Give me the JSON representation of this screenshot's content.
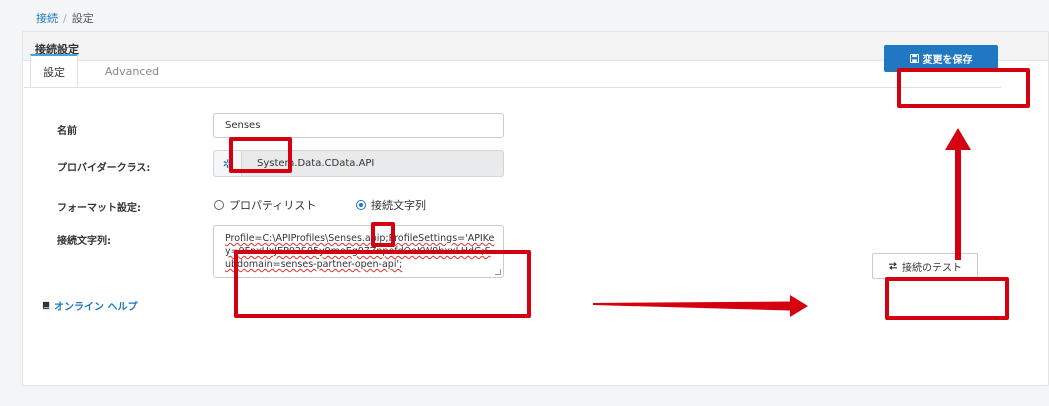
{
  "breadcrumb": {
    "parent": "接続",
    "separator": "/",
    "current": "設定"
  },
  "card": {
    "title": "接続設定"
  },
  "tabs": [
    {
      "label": "設定",
      "active": true
    },
    {
      "label": "Advanced",
      "active": false
    }
  ],
  "save_button": {
    "label": "変更を保存",
    "icon": "floppy-disk-icon"
  },
  "form": {
    "name": {
      "label": "名前",
      "value": "Senses"
    },
    "provider": {
      "label": "プロバイダークラス:",
      "value": "System.Data.CData.API",
      "icon": "gear-icon"
    },
    "format": {
      "label": "フォーマット設定:",
      "options": [
        {
          "label": "プロパティリスト",
          "selected": false
        },
        {
          "label": "接続文字列",
          "selected": true
        }
      ]
    },
    "connection_string": {
      "label": "接続文字列:",
      "value": "Profile=C:\\APIProfiles\\Senses.apip;ProfileSettings='APIKey=9FnxUxJEP02S05y9moEg97ZnpefdOoKW9bxxLHdG;Subdomain=senses-partner-open-api';"
    }
  },
  "help_link": {
    "label": "オンライン ヘルプ",
    "icon": "book-icon"
  },
  "test_button": {
    "label": "接続のテスト",
    "icon": "swap-arrows-icon"
  },
  "colors": {
    "primary": "#1f78c1",
    "annotation": "#d40010"
  }
}
